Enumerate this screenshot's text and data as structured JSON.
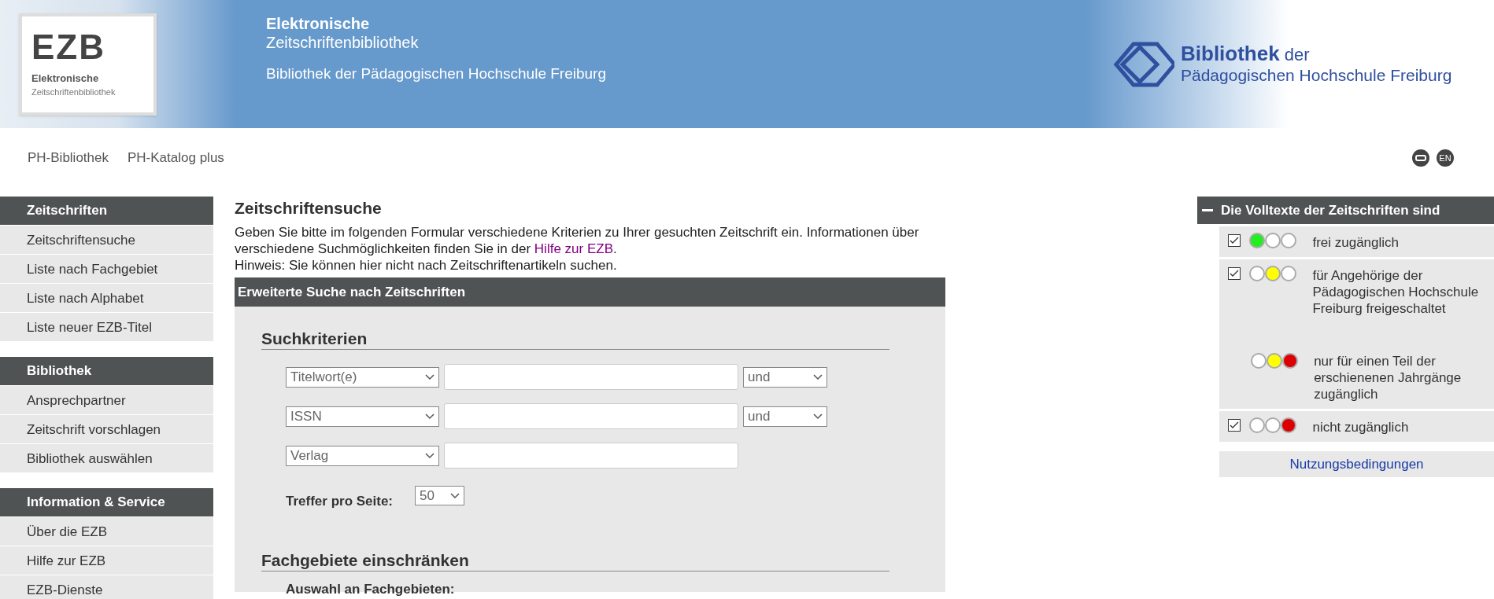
{
  "header": {
    "logo": {
      "mark": "EZB",
      "line1": "Elektronische",
      "line2": "Zeitschriftenbibliothek"
    },
    "title": "Elektronische",
    "subtitle": "Zeitschriftenbibliothek",
    "library": "Bibliothek der Pädagogischen Hochschule Freiburg",
    "partner_logo": {
      "bold": "Bibliothek",
      "rest": "der",
      "line2": "Pädagogischen Hochschule Freiburg"
    }
  },
  "top_links": [
    "PH-Bibliothek",
    "PH-Katalog plus"
  ],
  "language_button": "EN",
  "sidebar": [
    {
      "title": "Zeitschriften",
      "items": [
        "Zeitschriftensuche",
        "Liste nach Fachgebiet",
        "Liste nach Alphabet",
        "Liste neuer EZB-Titel"
      ]
    },
    {
      "title": "Bibliothek",
      "items": [
        "Ansprechpartner",
        "Zeitschrift vorschlagen",
        "Bibliothek auswählen"
      ]
    },
    {
      "title": "Information & Service",
      "items": [
        "Über die EZB",
        "Hilfe zur EZB",
        "EZB-Dienste"
      ]
    }
  ],
  "main": {
    "title": "Zeitschriftensuche",
    "intro": "Geben Sie bitte im folgenden Formular verschiedene Kriterien zu Ihrer gesuchten Zeitschrift ein. Informationen über verschiedene Suchmöglichkeiten finden Sie in der",
    "intro_link": "Hilfe zur EZB",
    "intro_end": ".",
    "hint": "Hinweis: Sie können hier nicht nach Zeitschriftenartikeln suchen.",
    "form": {
      "title": "Erweiterte Suche nach Zeitschriften",
      "criteria_heading": "Suchkriterien",
      "rows": [
        {
          "field": "Titelwort(e)",
          "operator": "und"
        },
        {
          "field": "ISSN",
          "operator": "und"
        },
        {
          "field": "Verlag"
        }
      ],
      "per_page_label": "Treffer pro Seite:",
      "per_page": "50",
      "subjects_heading": "Fachgebiete einschränken",
      "subjects_label": "Auswahl an Fachgebieten:"
    }
  },
  "legend": {
    "title": "Die Volltexte der Zeitschriften sind",
    "expanded": true,
    "groups": [
      {
        "entries": [
          {
            "kind": "option",
            "checked": true,
            "lights": [
              {
                "color": "#22ee22"
              },
              {
                "color": "#ffffff"
              },
              {
                "color": "#ffffff"
              }
            ],
            "label": "frei zugänglich"
          }
        ]
      },
      {
        "entries": [
          {
            "kind": "option",
            "checked": true,
            "lights": [
              {
                "color": "#ffffff"
              },
              {
                "color": "#ffff00"
              },
              {
                "color": "#ffffff"
              }
            ],
            "label": "für Angehörige der Pädagogischen Hochschule Freiburg freigeschaltet"
          },
          {
            "kind": "note",
            "lights": [
              {
                "color": "#ffffff"
              },
              {
                "color": "#ffff00"
              },
              {
                "color": "#dd0000"
              }
            ],
            "label": "nur für einen Teil der erschienenen Jahrgänge zugänglich"
          }
        ]
      },
      {
        "entries": [
          {
            "kind": "option",
            "checked": true,
            "lights": [
              {
                "color": "#ffffff"
              },
              {
                "color": "#ffffff"
              },
              {
                "color": "#dd0000"
              }
            ],
            "label": "nicht zugänglich"
          }
        ]
      }
    ],
    "terms_link": "Nutzungsbedingungen"
  }
}
